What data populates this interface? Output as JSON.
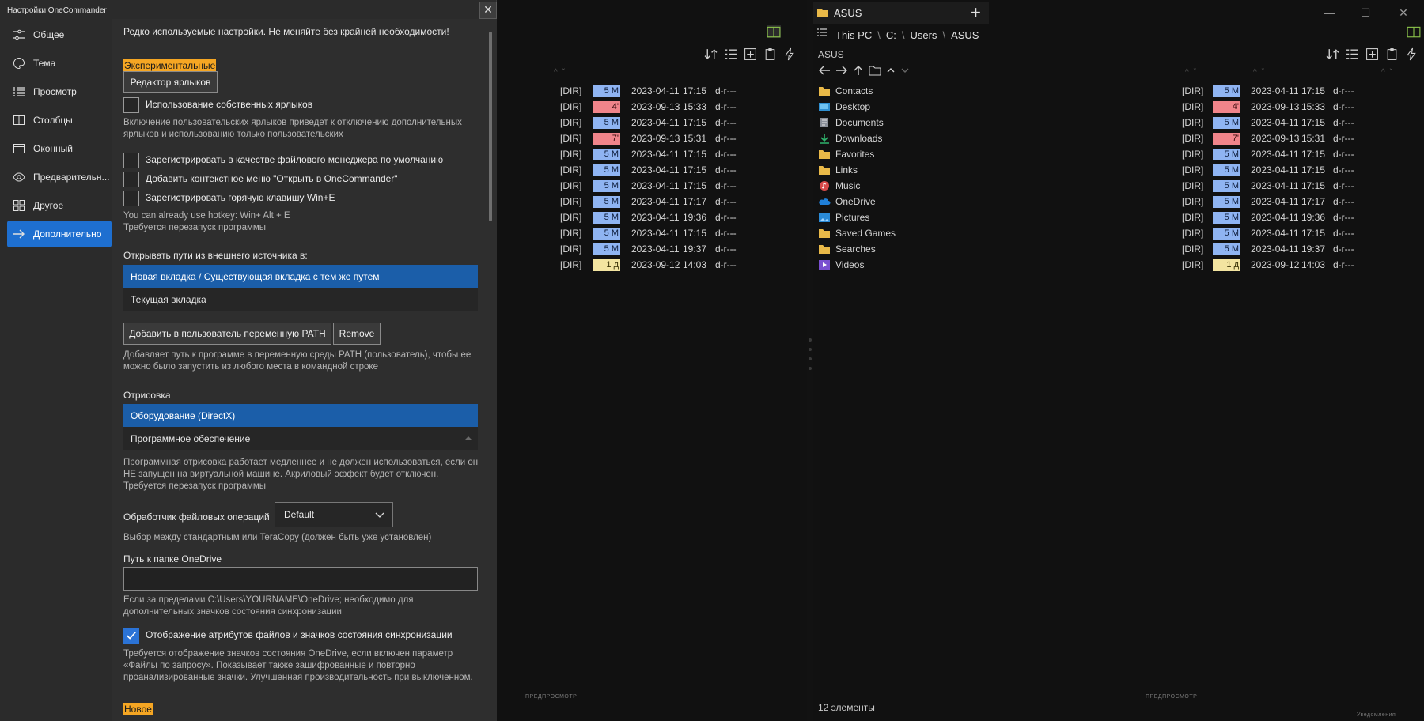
{
  "settings": {
    "title": "Настройки OneCommander",
    "close": "✕",
    "nav": [
      {
        "label": "Общее",
        "icon": "sliders-icon",
        "active": false
      },
      {
        "label": "Тема",
        "icon": "palette-icon",
        "active": false
      },
      {
        "label": "Просмотр",
        "icon": "list-view-icon",
        "active": false
      },
      {
        "label": "Столбцы",
        "icon": "columns-icon",
        "active": false
      },
      {
        "label": "Оконный",
        "icon": "window-icon",
        "active": false
      },
      {
        "label": "Предварительн...",
        "icon": "eye-icon",
        "active": false
      },
      {
        "label": "Другое",
        "icon": "grid-icon",
        "active": false
      },
      {
        "label": "Дополнительно",
        "icon": "arrow-right-icon",
        "active": true
      }
    ],
    "intro": "Редко используемые настройки. Не меняйте без крайней необходимости!",
    "experimental_badge": "Экспериментальные",
    "label_editor_button": "Редактор ярлыков",
    "custom_labels": {
      "label": "Использование собственных ярлыков",
      "checked": false,
      "note": "Включение пользовательских ярлыков приведет к отключению дополнительных ярлыков и использованию только пользовательских"
    },
    "register_default": {
      "label": "Зарегистрировать в качестве файлового менеджера по умолчанию",
      "checked": false
    },
    "context_menu": {
      "label": "Добавить контекстное меню \"Открыть в OneCommander\"",
      "checked": false
    },
    "hotkey": {
      "label": "Зарегистрировать горячую клавишу Win+E",
      "checked": false
    },
    "hotkey_note_1": "You can already use hotkey:  Win+ Alt + E",
    "hotkey_note_2": "Требуется перезапуск программы",
    "open_paths_label": "Открывать пути из внешнего источника в:",
    "open_paths_options": [
      {
        "label": "Новая вкладка  /  Существующая вкладка с тем же путем",
        "selected": true
      },
      {
        "label": "Текущая вкладка",
        "selected": false
      }
    ],
    "path_add_button": "Добавить в пользователь переменную PATH",
    "path_remove_button": "Remove",
    "path_note": "Добавляет путь к программе в переменную среды PATH (пользователь), чтобы ее можно было запустить из любого места в командной строке",
    "render_label": "Отрисовка",
    "render_options": [
      {
        "label": "Оборудование (DirectX)",
        "selected": true
      },
      {
        "label": "Программное обеспечение",
        "selected": false
      }
    ],
    "render_note": "Программная отрисовка работает медленнее и не должен использоваться, если он НЕ запущен на виртуальной машине. Акриловый эффект будет отключен. Требуется перезапуск программы",
    "file_ops_label": "Обработчик файловых операций",
    "file_ops_value": "Default",
    "file_ops_note": "Выбор между стандартным или TeraCopy (должен быть уже установлен)",
    "onedrive_label": "Путь к папке OneDrive",
    "onedrive_value": "",
    "onedrive_note": "Если за пределами C:\\Users\\YOURNAME\\OneDrive; необходимо для дополнительных значков состояния синхронизации",
    "sync_attrs": {
      "label": "Отображение атрибутов файлов и значков состояния синхронизации",
      "checked": true
    },
    "sync_note": "Требуется отображение значков состояния OneDrive, если включен параметр «Файлы по запросу». Показывает также зашифрованные и повторно проанализированные значки. Улучшенная производительность при выключенном.",
    "new_badge": "Новое"
  },
  "right_pane": {
    "tab_title": "ASUS",
    "add_tab": "+",
    "window_controls": [
      "—",
      "☐",
      "✕"
    ],
    "breadcrumb": [
      "This PC",
      "C:",
      "Users",
      "ASUS"
    ],
    "path_box": "ASUS",
    "status": "12 элементы",
    "preview_label": "ПРЕДПРОСМОТР",
    "minimized_label": "Уведомления"
  },
  "left_pane": {
    "preview_label": "ПРЕДПРОСМОТР"
  },
  "files": [
    {
      "name": "Contacts",
      "icon": "folder-icon",
      "type": "[DIR]",
      "size": "5 M",
      "chip": "blue",
      "date": "2023-04-11",
      "time": "17:15",
      "attrs": "d-r---"
    },
    {
      "name": "Desktop",
      "icon": "desktop-folder-icon",
      "type": "[DIR]",
      "size": "4'",
      "chip": "red",
      "date": "2023-09-13",
      "time": "15:33",
      "attrs": "d-r---"
    },
    {
      "name": "Documents",
      "icon": "documents-folder-icon",
      "type": "[DIR]",
      "size": "5 M",
      "chip": "blue",
      "date": "2023-04-11",
      "time": "17:15",
      "attrs": "d-r---"
    },
    {
      "name": "Downloads",
      "icon": "download-icon",
      "type": "[DIR]",
      "size": "7'",
      "chip": "red",
      "date": "2023-09-13",
      "time": "15:31",
      "attrs": "d-r---"
    },
    {
      "name": "Favorites",
      "icon": "folder-icon",
      "type": "[DIR]",
      "size": "5 M",
      "chip": "blue",
      "date": "2023-04-11",
      "time": "17:15",
      "attrs": "d-r---"
    },
    {
      "name": "Links",
      "icon": "folder-icon",
      "type": "[DIR]",
      "size": "5 M",
      "chip": "blue",
      "date": "2023-04-11",
      "time": "17:15",
      "attrs": "d-r---"
    },
    {
      "name": "Music",
      "icon": "music-icon",
      "type": "[DIR]",
      "size": "5 M",
      "chip": "blue",
      "date": "2023-04-11",
      "time": "17:15",
      "attrs": "d-r---"
    },
    {
      "name": "OneDrive",
      "icon": "onedrive-icon",
      "type": "[DIR]",
      "size": "5 M",
      "chip": "blue",
      "date": "2023-04-11",
      "time": "17:17",
      "attrs": "d-r---"
    },
    {
      "name": "Pictures",
      "icon": "pictures-icon",
      "type": "[DIR]",
      "size": "5 M",
      "chip": "blue",
      "date": "2023-04-11",
      "time": "19:36",
      "attrs": "d-r---"
    },
    {
      "name": "Saved Games",
      "icon": "folder-icon",
      "type": "[DIR]",
      "size": "5 M",
      "chip": "blue",
      "date": "2023-04-11",
      "time": "17:15",
      "attrs": "d-r---"
    },
    {
      "name": "Searches",
      "icon": "folder-icon",
      "type": "[DIR]",
      "size": "5 M",
      "chip": "blue",
      "date": "2023-04-11",
      "time": "19:37",
      "attrs": "d-r---"
    },
    {
      "name": "Videos",
      "icon": "videos-icon",
      "type": "[DIR]",
      "size": "1 д",
      "chip": "yellow",
      "date": "2023-09-12",
      "time": "14:03",
      "attrs": "d-r---"
    }
  ],
  "colors": {
    "accent": "#1e6fd0",
    "selection": "#1b5ea9",
    "badge_orange": "#f5a623",
    "chip_blue": "#8fb4f2",
    "chip_red": "#f0848a",
    "chip_yellow": "#f3e4a0",
    "folder": "#e9b948"
  }
}
